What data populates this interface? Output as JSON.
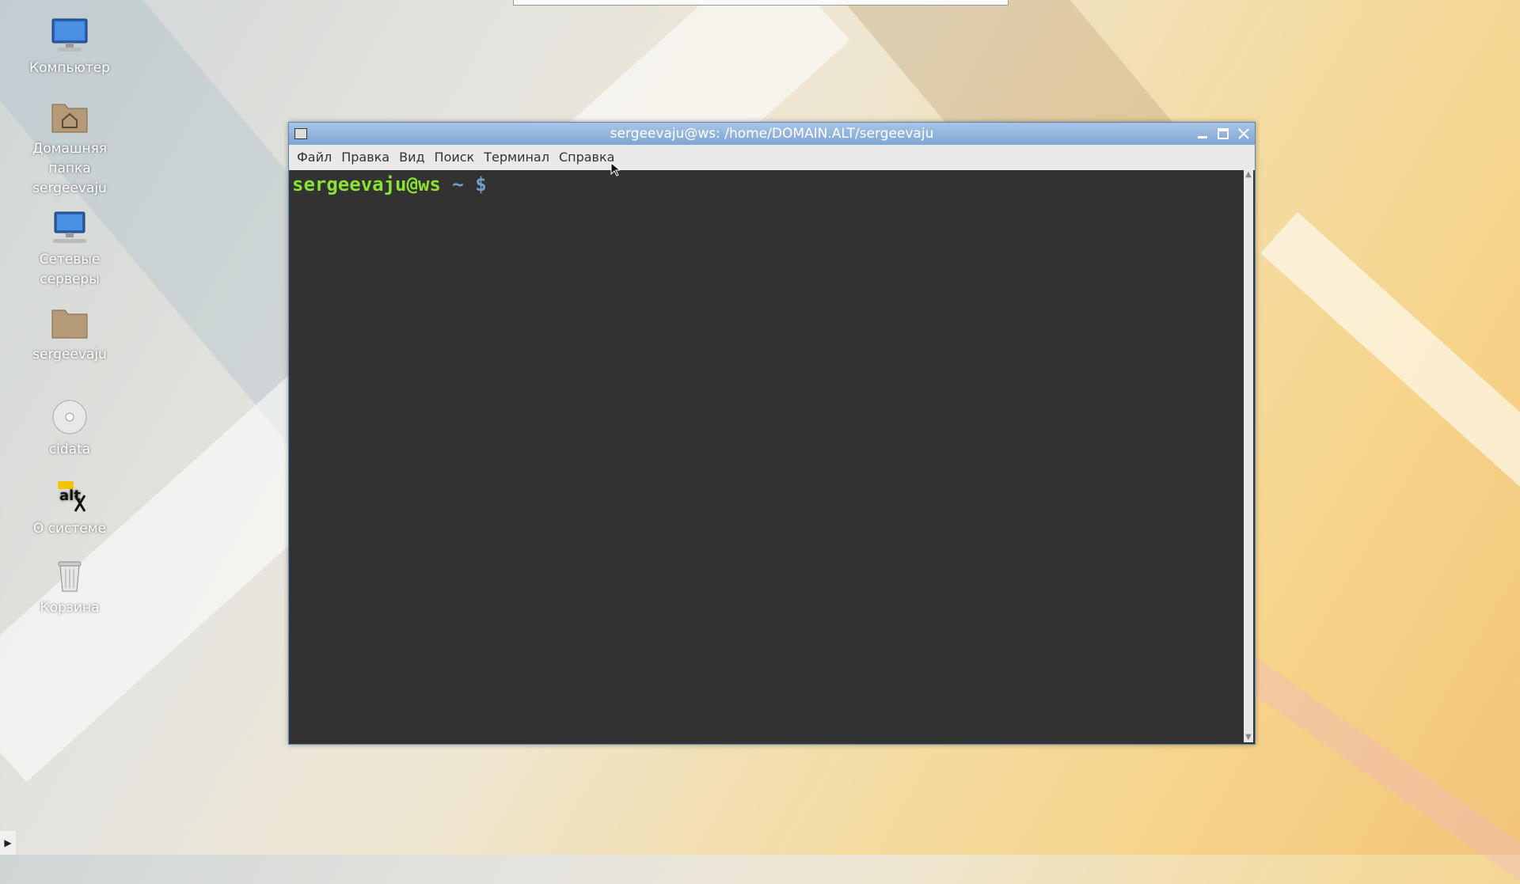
{
  "desktop": {
    "icons": [
      {
        "label": "Компьютер",
        "icon": "computer-icon"
      },
      {
        "label": "Домашняя папка sergeevaju",
        "icon": "home-folder-icon"
      },
      {
        "label": "Сетевые серверы",
        "icon": "network-servers-icon"
      },
      {
        "label": "sergeevaju",
        "icon": "folder-icon"
      },
      {
        "label": "cidata",
        "icon": "cd-drive-icon"
      },
      {
        "label": "О системе",
        "icon": "alt-logo-icon"
      },
      {
        "label": "Корзина",
        "icon": "trash-icon"
      }
    ]
  },
  "window": {
    "title": "sergeevaju@ws: /home/DOMAIN.ALT/sergeevaju",
    "menu": [
      "Файл",
      "Правка",
      "Вид",
      "Поиск",
      "Терминал",
      "Справка"
    ],
    "prompt": {
      "user_host": "sergeevaju@ws",
      "path": "~",
      "symbol": "$"
    }
  },
  "colors": {
    "prompt_green": "#8ae234",
    "prompt_blue": "#729fcf",
    "terminal_bg": "#323232",
    "titlebar": "#7fa5d1"
  }
}
